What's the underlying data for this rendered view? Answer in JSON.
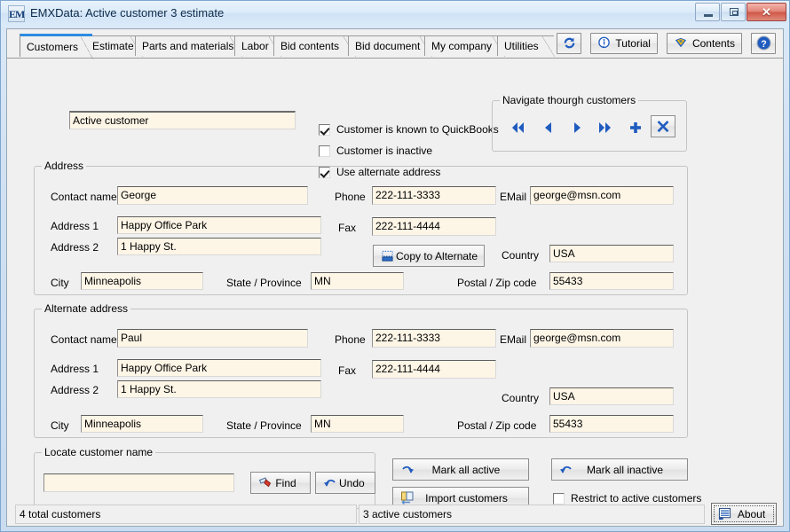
{
  "window": {
    "title": "EMXData:  Active customer 3 estimate",
    "icon_label": "EM",
    "icon_name": "app-icon",
    "minimize_label": "–",
    "maximize_label": "□",
    "close_label": "✕"
  },
  "tabs": [
    {
      "label": "Customers",
      "active": true
    },
    {
      "label": "Estimate",
      "active": false
    },
    {
      "label": "Parts and materials",
      "active": false
    },
    {
      "label": "Labor",
      "active": false
    },
    {
      "label": "Bid contents",
      "active": false
    },
    {
      "label": "Bid document",
      "active": false
    },
    {
      "label": "My company",
      "active": false
    },
    {
      "label": "Utilities",
      "active": false
    }
  ],
  "toolbar": {
    "refresh_label": "",
    "tutorial_label": "Tutorial",
    "contents_label": "Contents",
    "help_label": ""
  },
  "customer": {
    "name_value": "Active customer",
    "checkbox_quickbooks": {
      "label": "Customer is known to QuickBooks",
      "checked": true
    },
    "checkbox_inactive": {
      "label": "Customer is inactive",
      "checked": false
    },
    "checkbox_alternate": {
      "label": "Use alternate address",
      "checked": true
    }
  },
  "navigate": {
    "caption": "Navigate thourgh customers",
    "buttons": [
      {
        "name": "first",
        "glyph": "«"
      },
      {
        "name": "previous",
        "glyph": "◀"
      },
      {
        "name": "next",
        "glyph": "▶"
      },
      {
        "name": "last",
        "glyph": "»"
      },
      {
        "name": "add",
        "glyph": "+"
      },
      {
        "name": "delete",
        "glyph": "✕"
      }
    ]
  },
  "address": {
    "caption": "Address",
    "contact_label": "Contact name",
    "contact_value": "George",
    "address1_label": "Address 1",
    "address1_value": "Happy Office Park",
    "address2_label": "Address 2",
    "address2_value": "1 Happy St.",
    "city_label": "City",
    "city_value": "Minneapolis",
    "state_label": "State / Province",
    "state_value": "MN",
    "phone_label": "Phone",
    "phone_value": "222-111-3333",
    "fax_label": "Fax",
    "fax_value": "222-111-4444",
    "email_label": "EMail",
    "email_value": "george@msn.com",
    "country_label": "Country",
    "country_value": "USA",
    "postal_label": "Postal / Zip code",
    "postal_value": "55433",
    "copy_button_label": "Copy to Alternate"
  },
  "alternate": {
    "caption": "Alternate address",
    "contact_label": "Contact name",
    "contact_value": "Paul",
    "address1_label": "Address 1",
    "address1_value": "Happy Office Park",
    "address2_label": "Address 2",
    "address2_value": "1 Happy St.",
    "city_label": "City",
    "city_value": "Minneapolis",
    "state_label": "State / Province",
    "state_value": "MN",
    "phone_label": "Phone",
    "phone_value": "222-111-3333",
    "fax_label": "Fax",
    "fax_value": "222-111-4444",
    "email_label": "EMail",
    "email_value": "george@msn.com",
    "country_label": "Country",
    "country_value": "USA",
    "postal_label": "Postal / Zip code",
    "postal_value": "55433"
  },
  "locate": {
    "caption": "Locate customer name",
    "input_value": "",
    "find_label": "Find",
    "undo_label": "Undo"
  },
  "actions": {
    "mark_all_active": "Mark all active",
    "mark_all_inactive": "Mark all inactive",
    "import_customers": "Import customers",
    "restrict_checkbox": {
      "label": "Restrict to active customers",
      "checked": false
    }
  },
  "statusbar": {
    "total_customers": "4 total customers",
    "active_customers": "3 active customers",
    "about_label": "About"
  },
  "colors": {
    "field_bg": "#fdf5e6",
    "form_bg": "#f0f0f0",
    "accent_blue": "#2e8ce0",
    "icon_blue": "#1f5bbf"
  }
}
